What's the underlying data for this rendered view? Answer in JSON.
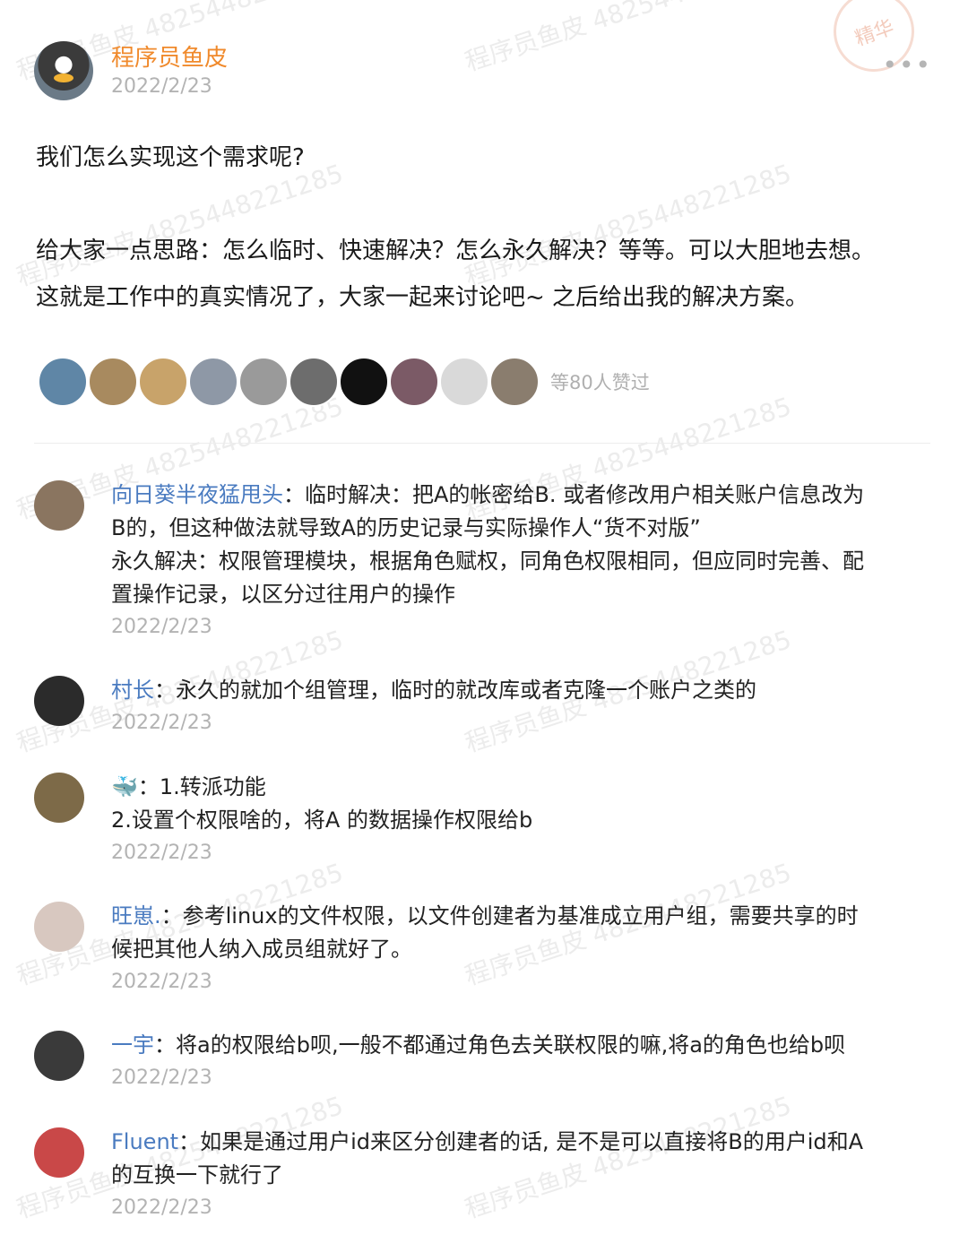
{
  "author": {
    "name": "程序员鱼皮",
    "date": "2022/2/23"
  },
  "more_label": "•••",
  "post": {
    "line1": "我们怎么实现这个需求呢?",
    "line2": "给大家一点思路：怎么临时、快速解决？怎么永久解决？等等。可以大胆地去想。",
    "line3": "这就是工作中的真实情况了，大家一起来讨论吧~ 之后给出我的解决方案。"
  },
  "likes": {
    "text": "等80人赞过",
    "avatar_colors": [
      "#5f86a6",
      "#a88a5f",
      "#c8a36a",
      "#8e98a6",
      "#9a9a9a",
      "#6d6d6d",
      "#111111",
      "#7b5a66",
      "#d9d9d9",
      "#8a7d6e"
    ]
  },
  "comments": [
    {
      "name": "向日葵半夜猛甩头",
      "sep": "：",
      "text_lines": [
        "临时解决：把A的帐密给B. 或者修改用户相关账户信息改为",
        "B的，但这种做法就导致A的历史记录与实际操作人“货不对版”",
        "永久解决：权限管理模块，根据角色赋权，同角色权限相同，但应同时完善、配",
        "置操作记录，以区分过往用户的操作"
      ],
      "date": "2022/2/23",
      "avatar_color": "#8a7560"
    },
    {
      "name": "村长",
      "sep": "：",
      "text_lines": [
        "永久的就加个组管理，临时的就改库或者克隆一个账户之类的"
      ],
      "date": "2022/2/23",
      "avatar_color": "#2b2b2b"
    },
    {
      "name": "🐳",
      "sep": "：",
      "text_lines": [
        "1.转派功能",
        "2.设置个权限啥的，将A 的数据操作权限给b"
      ],
      "date": "2022/2/23",
      "avatar_color": "#7d6a48"
    },
    {
      "name": "旺崽.",
      "sep": "：",
      "text_lines": [
        "参考linux的文件权限，以文件创建者为基准成立用户组，需要共享的时",
        "候把其他人纳入成员组就好了。"
      ],
      "date": "2022/2/23",
      "avatar_color": "#d8c8c0"
    },
    {
      "name": "一宇",
      "sep": "：",
      "text_lines": [
        "将a的权限给b呗,一般不都通过角色去关联权限的嘛,将a的角色也给b呗"
      ],
      "date": "2022/2/23",
      "avatar_color": "#3a3a3a"
    },
    {
      "name": "Fluent",
      "sep": "：",
      "text_lines": [
        "如果是通过用户id来区分创建者的话, 是不是可以直接将B的用户id和A",
        "的互换一下就行了"
      ],
      "date": "2022/2/23",
      "avatar_color": "#c94848"
    }
  ],
  "watermark": "程序员鱼皮 4825448221285",
  "stamp": "精华"
}
